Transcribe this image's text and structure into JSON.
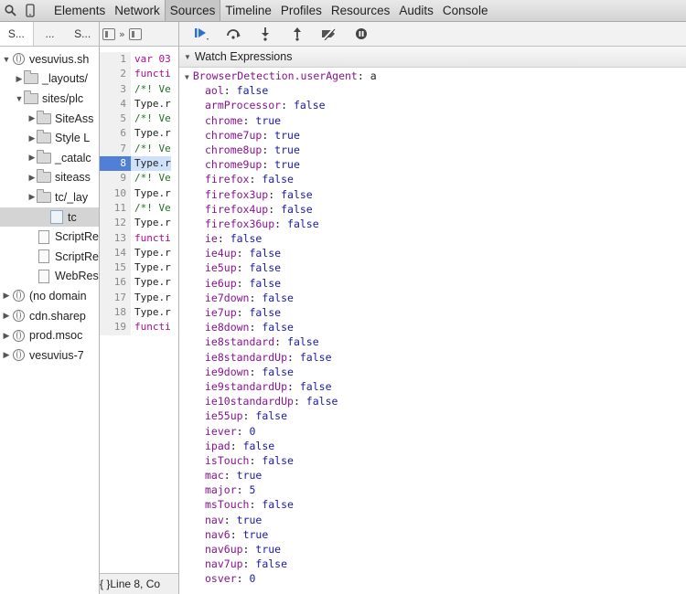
{
  "toolbar": {
    "tabs": [
      "Elements",
      "Network",
      "Sources",
      "Timeline",
      "Profiles",
      "Resources",
      "Audits",
      "Console"
    ],
    "active_tab": "Sources"
  },
  "navigator": {
    "tabs": [
      "S...",
      "...",
      "S..."
    ],
    "tree": [
      {
        "label": "vesuvius.sh",
        "icon": "globe-icon",
        "indent": 0,
        "arrow": "▼"
      },
      {
        "label": "_layouts/",
        "icon": "folder-icon",
        "indent": 1,
        "arrow": "▶"
      },
      {
        "label": "sites/plc",
        "icon": "folder-icon",
        "indent": 1,
        "arrow": "▼"
      },
      {
        "label": "SiteAss",
        "icon": "folder-icon",
        "indent": 2,
        "arrow": "▶"
      },
      {
        "label": "Style L",
        "icon": "folder-icon",
        "indent": 2,
        "arrow": "▶"
      },
      {
        "label": "_catalc",
        "icon": "folder-icon",
        "indent": 2,
        "arrow": "▶"
      },
      {
        "label": "siteass",
        "icon": "folder-icon",
        "indent": 2,
        "arrow": "▶"
      },
      {
        "label": "tc/_lay",
        "icon": "folder-icon",
        "indent": 2,
        "arrow": "▶"
      },
      {
        "label": "tc",
        "icon": "js-file-icon",
        "indent": 3,
        "arrow": "",
        "selected": true
      },
      {
        "label": "ScriptRes",
        "icon": "file-icon",
        "indent": 2,
        "arrow": ""
      },
      {
        "label": "ScriptRes",
        "icon": "file-icon",
        "indent": 2,
        "arrow": ""
      },
      {
        "label": "WebReso",
        "icon": "file-icon",
        "indent": 2,
        "arrow": ""
      },
      {
        "label": "(no domain",
        "icon": "globe-icon",
        "indent": 0,
        "arrow": "▶"
      },
      {
        "label": "cdn.sharep",
        "icon": "globe-icon",
        "indent": 0,
        "arrow": "▶"
      },
      {
        "label": "prod.msoc",
        "icon": "globe-icon",
        "indent": 0,
        "arrow": "▶"
      },
      {
        "label": "vesuvius-7",
        "icon": "globe-icon",
        "indent": 0,
        "arrow": "▶"
      }
    ]
  },
  "editor": {
    "toolbar_glyph": "»",
    "lines": [
      {
        "n": "1",
        "text": "var 03",
        "kind": "kw"
      },
      {
        "n": "2",
        "text": "functi",
        "kind": "kw"
      },
      {
        "n": "3",
        "text": "/*! Ve",
        "kind": "cm"
      },
      {
        "n": "4",
        "text": "Type.r",
        "kind": ""
      },
      {
        "n": "5",
        "text": "/*! Ve",
        "kind": "cm"
      },
      {
        "n": "6",
        "text": "Type.r",
        "kind": ""
      },
      {
        "n": "7",
        "text": "/*! Ve",
        "kind": "cm"
      },
      {
        "n": "8",
        "text": "Type.r",
        "kind": "",
        "breakpoint": true
      },
      {
        "n": "9",
        "text": "/*! Ve",
        "kind": "cm"
      },
      {
        "n": "10",
        "text": "Type.r",
        "kind": ""
      },
      {
        "n": "11",
        "text": "/*! Ve",
        "kind": "cm"
      },
      {
        "n": "12",
        "text": "Type.r",
        "kind": ""
      },
      {
        "n": "13",
        "text": "functi",
        "kind": "kw"
      },
      {
        "n": "14",
        "text": "Type.r",
        "kind": ""
      },
      {
        "n": "15",
        "text": "Type.r",
        "kind": ""
      },
      {
        "n": "16",
        "text": "Type.r",
        "kind": ""
      },
      {
        "n": "17",
        "text": "Type.r",
        "kind": ""
      },
      {
        "n": "18",
        "text": "Type.r",
        "kind": ""
      },
      {
        "n": "19",
        "text": "functi",
        "kind": "kw"
      }
    ],
    "status": "{ }Line 8, Co"
  },
  "debugger": {
    "section_title": "Watch Expressions",
    "root": {
      "name": "BrowserDetection.userAgent",
      "value": "a"
    },
    "properties": [
      {
        "name": "aol",
        "value": "false"
      },
      {
        "name": "armProcessor",
        "value": "false"
      },
      {
        "name": "chrome",
        "value": "true"
      },
      {
        "name": "chrome7up",
        "value": "true"
      },
      {
        "name": "chrome8up",
        "value": "true"
      },
      {
        "name": "chrome9up",
        "value": "true"
      },
      {
        "name": "firefox",
        "value": "false"
      },
      {
        "name": "firefox3up",
        "value": "false"
      },
      {
        "name": "firefox4up",
        "value": "false"
      },
      {
        "name": "firefox36up",
        "value": "false"
      },
      {
        "name": "ie",
        "value": "false"
      },
      {
        "name": "ie4up",
        "value": "false"
      },
      {
        "name": "ie5up",
        "value": "false"
      },
      {
        "name": "ie6up",
        "value": "false"
      },
      {
        "name": "ie7down",
        "value": "false"
      },
      {
        "name": "ie7up",
        "value": "false"
      },
      {
        "name": "ie8down",
        "value": "false"
      },
      {
        "name": "ie8standard",
        "value": "false"
      },
      {
        "name": "ie8standardUp",
        "value": "false"
      },
      {
        "name": "ie9down",
        "value": "false"
      },
      {
        "name": "ie9standardUp",
        "value": "false"
      },
      {
        "name": "ie10standardUp",
        "value": "false"
      },
      {
        "name": "ie55up",
        "value": "false"
      },
      {
        "name": "iever",
        "value": "0"
      },
      {
        "name": "ipad",
        "value": "false"
      },
      {
        "name": "isTouch",
        "value": "false"
      },
      {
        "name": "mac",
        "value": "true"
      },
      {
        "name": "major",
        "value": "5"
      },
      {
        "name": "msTouch",
        "value": "false"
      },
      {
        "name": "nav",
        "value": "true"
      },
      {
        "name": "nav6",
        "value": "true"
      },
      {
        "name": "nav6up",
        "value": "true"
      },
      {
        "name": "nav7up",
        "value": "false"
      },
      {
        "name": "osver",
        "value": "0"
      }
    ]
  }
}
